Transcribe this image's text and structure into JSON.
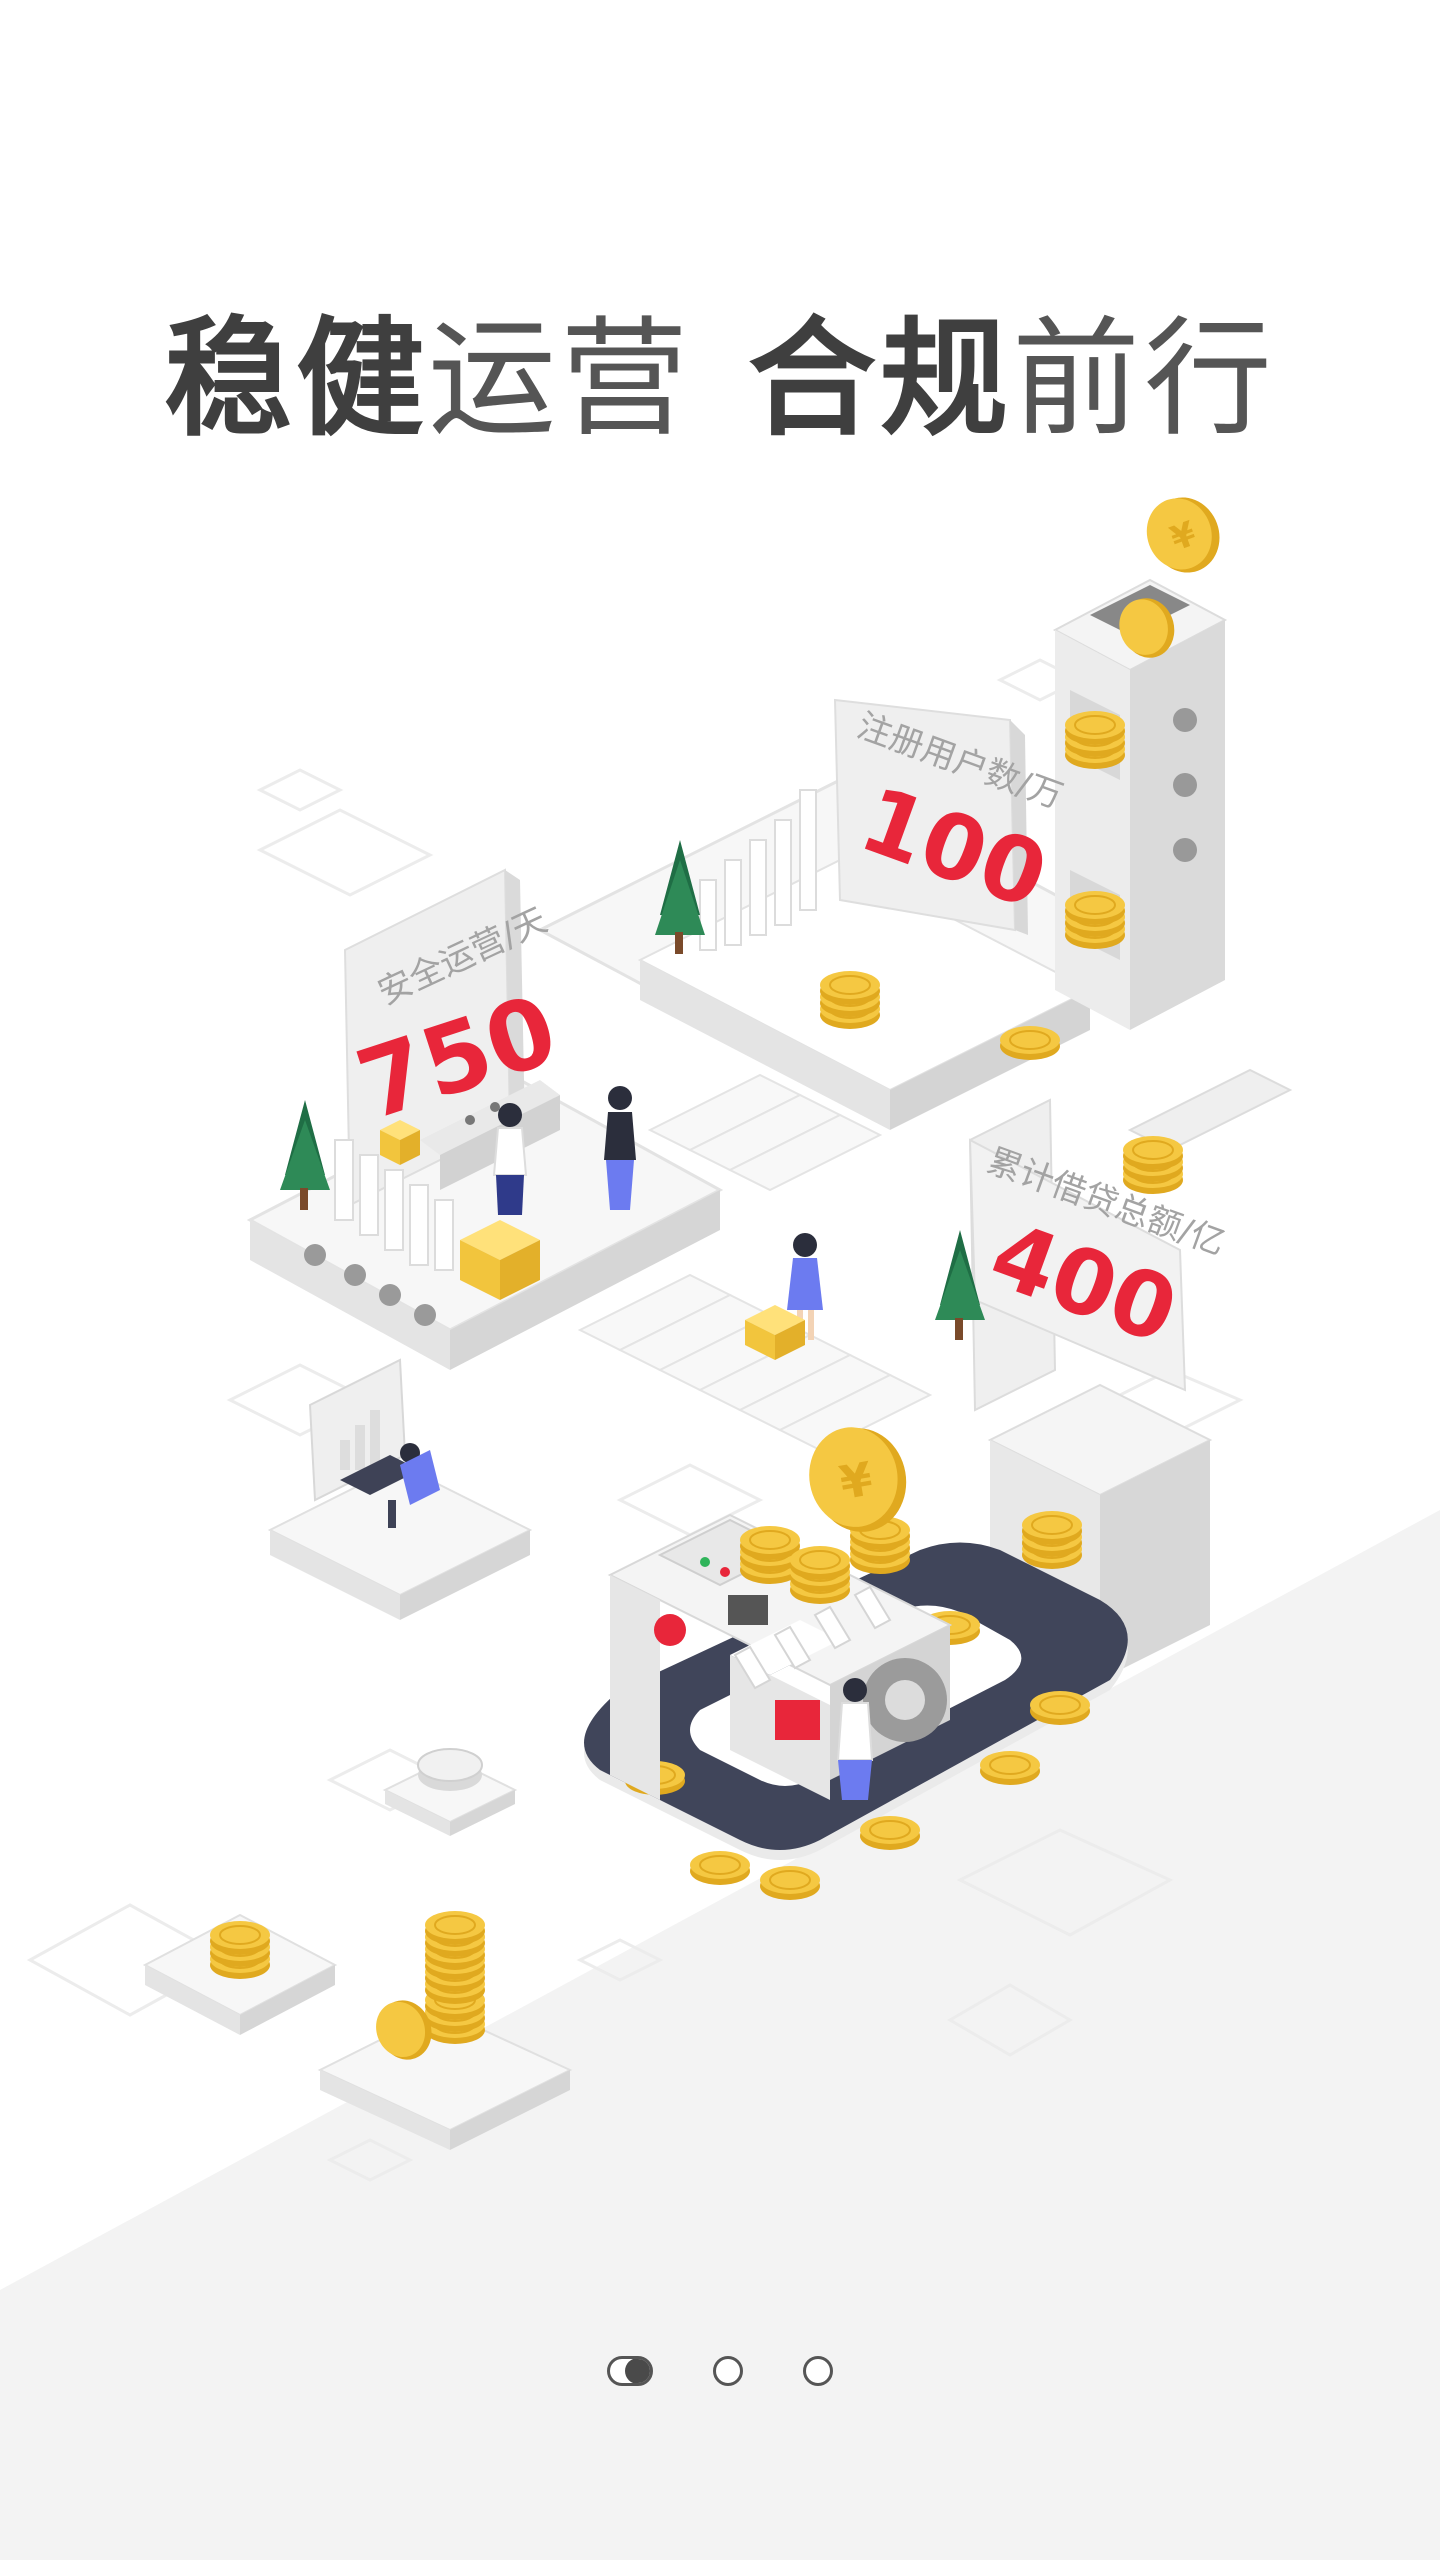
{
  "headline": {
    "part1_bold": "稳健",
    "part1_light": "运营",
    "part2_bold": "合规",
    "part2_light": "前行"
  },
  "stats": [
    {
      "label": "安全运营/天",
      "value": "750"
    },
    {
      "label": "注册用户数/万",
      "value": "100"
    },
    {
      "label": "累计借贷总额/亿",
      "value": "400"
    }
  ],
  "coin_symbol": "¥",
  "pager": {
    "total": 3,
    "active": 1
  },
  "colors": {
    "accent_red": "#e8263a",
    "coin_gold": "#f5c842",
    "conveyor_dark": "#40455a",
    "floor_gray": "#f3f3f3"
  }
}
